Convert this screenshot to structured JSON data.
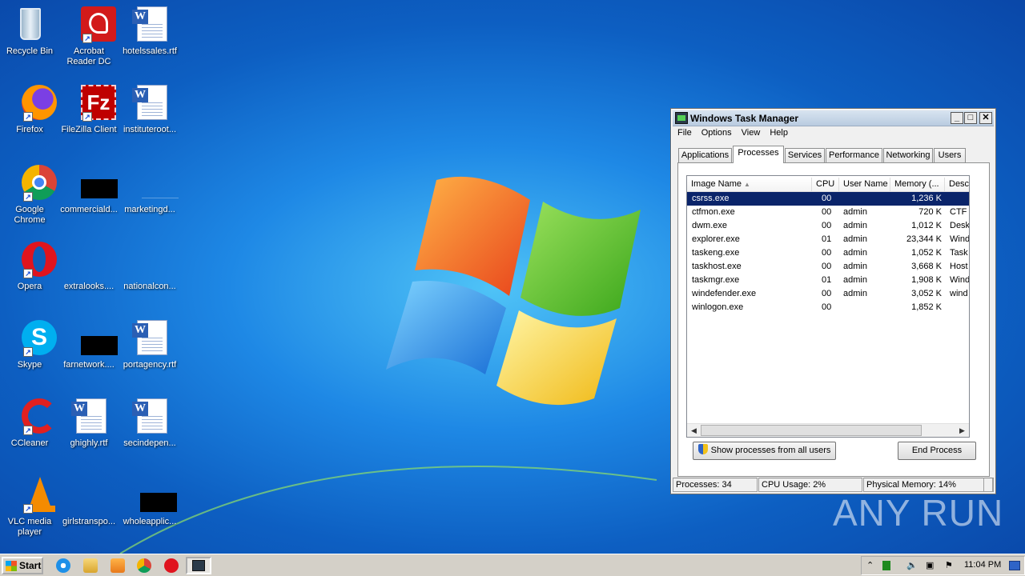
{
  "desktop": {
    "icons": [
      {
        "label": "Recycle Bin"
      },
      {
        "label": "Acrobat Reader DC"
      },
      {
        "label": "hotelssales.rtf"
      },
      {
        "label": "Firefox"
      },
      {
        "label": "FileZilla Client"
      },
      {
        "label": "instituteroot..."
      },
      {
        "label": "Google Chrome"
      },
      {
        "label": "commerciald..."
      },
      {
        "label": "marketingd..."
      },
      {
        "label": "Opera"
      },
      {
        "label": "extralooks...."
      },
      {
        "label": "nationalcon..."
      },
      {
        "label": "Skype"
      },
      {
        "label": "farnetwork...."
      },
      {
        "label": "portagency.rtf"
      },
      {
        "label": "CCleaner"
      },
      {
        "label": "ghighly.rtf"
      },
      {
        "label": "secindepen..."
      },
      {
        "label": "VLC media player"
      },
      {
        "label": "girlstranspo..."
      },
      {
        "label": "wholeapplic..."
      }
    ]
  },
  "taskmanager": {
    "title": "Windows Task Manager",
    "menu": [
      "File",
      "Options",
      "View",
      "Help"
    ],
    "tabs": [
      "Applications",
      "Processes",
      "Services",
      "Performance",
      "Networking",
      "Users"
    ],
    "active_tab": "Processes",
    "columns": [
      "Image Name",
      "CPU",
      "User Name",
      "Memory (...",
      "Desc"
    ],
    "rows": [
      {
        "name": "csrss.exe",
        "cpu": "00",
        "user": "",
        "mem": "1,236 K",
        "desc": ""
      },
      {
        "name": "ctfmon.exe",
        "cpu": "00",
        "user": "admin",
        "mem": "720 K",
        "desc": "CTF l"
      },
      {
        "name": "dwm.exe",
        "cpu": "00",
        "user": "admin",
        "mem": "1,012 K",
        "desc": "Desk"
      },
      {
        "name": "explorer.exe",
        "cpu": "01",
        "user": "admin",
        "mem": "23,344 K",
        "desc": "Wind"
      },
      {
        "name": "taskeng.exe",
        "cpu": "00",
        "user": "admin",
        "mem": "1,052 K",
        "desc": "Task"
      },
      {
        "name": "taskhost.exe",
        "cpu": "00",
        "user": "admin",
        "mem": "3,668 K",
        "desc": "Host"
      },
      {
        "name": "taskmgr.exe",
        "cpu": "01",
        "user": "admin",
        "mem": "1,908 K",
        "desc": "Wind"
      },
      {
        "name": "windefender.exe",
        "cpu": "00",
        "user": "admin",
        "mem": "3,052 K",
        "desc": "wind"
      },
      {
        "name": "winlogon.exe",
        "cpu": "00",
        "user": "",
        "mem": "1,852 K",
        "desc": ""
      }
    ],
    "show_all_button": "Show processes from all users",
    "end_process_button": "End Process",
    "status": {
      "processes": "Processes: 34",
      "cpu": "CPU Usage: 2%",
      "memory": "Physical Memory: 14%"
    }
  },
  "watermark": "ANY RUN",
  "taskbar": {
    "start_label": "Start",
    "clock": "11:04 PM"
  }
}
